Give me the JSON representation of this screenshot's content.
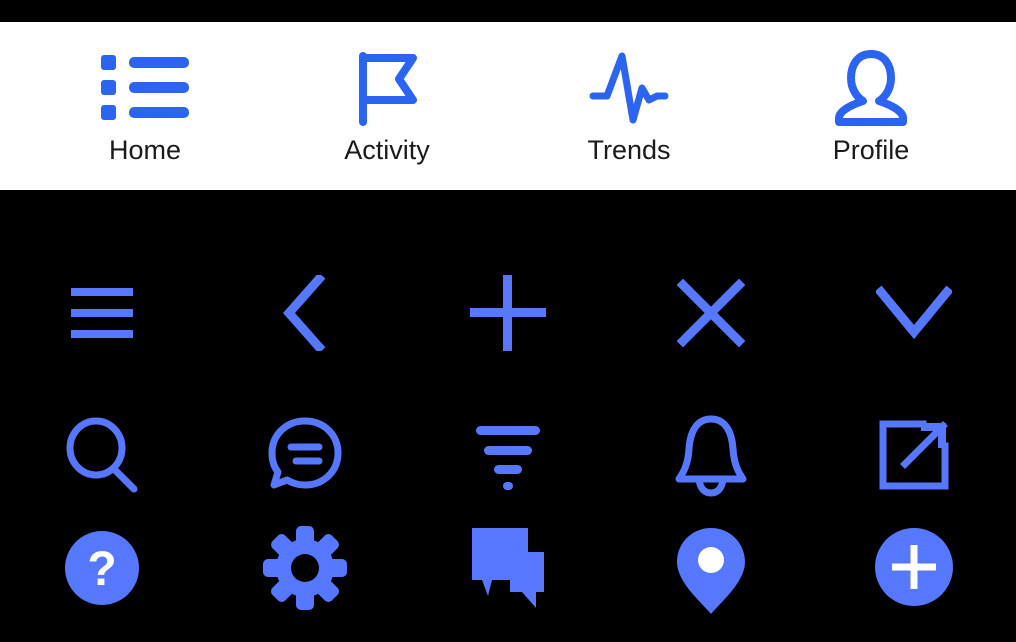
{
  "theme": {
    "background": "#000000",
    "topbar_background": "#ffffff",
    "accent_blue_light_bg": "#2C64F2",
    "accent_blue_dark_bg": "#5578FF",
    "label_color": "#1b1b1b",
    "glyph_knockout": "#ffffff"
  },
  "topbar": {
    "items": [
      {
        "label": "Home",
        "icon": "list-icon"
      },
      {
        "label": "Activity",
        "icon": "flag-icon"
      },
      {
        "label": "Trends",
        "icon": "pulse-icon"
      },
      {
        "label": "Profile",
        "icon": "person-icon"
      }
    ]
  },
  "icon_grid": {
    "rows": [
      {
        "cells": [
          {
            "icon": "hamburger-menu-icon",
            "name": "menu"
          },
          {
            "icon": "chevron-left-icon",
            "name": "back"
          },
          {
            "icon": "plus-icon",
            "name": "add"
          },
          {
            "icon": "close-icon",
            "name": "close"
          },
          {
            "icon": "chevron-down-icon",
            "name": "expand"
          }
        ]
      },
      {
        "cells": [
          {
            "icon": "search-icon",
            "name": "search"
          },
          {
            "icon": "chat-bubble-icon",
            "name": "message"
          },
          {
            "icon": "filter-icon",
            "name": "filter"
          },
          {
            "icon": "bell-icon",
            "name": "notifications"
          },
          {
            "icon": "external-link-icon",
            "name": "open-external"
          }
        ]
      },
      {
        "cells": [
          {
            "icon": "help-circle-icon",
            "name": "help"
          },
          {
            "icon": "gear-icon",
            "name": "settings"
          },
          {
            "icon": "comments-icon",
            "name": "comments"
          },
          {
            "icon": "map-pin-icon",
            "name": "location"
          },
          {
            "icon": "floating-action-add-icon",
            "name": "create"
          }
        ]
      }
    ]
  }
}
